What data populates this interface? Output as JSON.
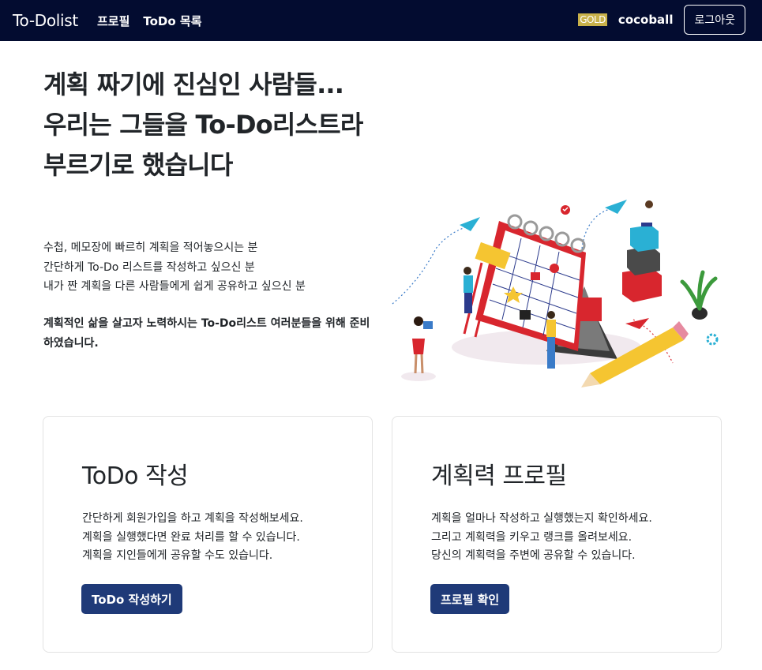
{
  "navbar": {
    "brand": "To-Dolist",
    "links": [
      "프로필",
      "ToDo 목록"
    ],
    "rank_badge": "GOLD",
    "username": "cocoball",
    "logout_label": "로그아웃",
    "bg_color": "#030c30",
    "badge_color": "#c8b14a"
  },
  "hero": {
    "title_lines": [
      "계획 짜기에 진심인 사람들...",
      "우리는 그들을 To-Do리스트라",
      "부르기로 했습니다"
    ],
    "desc_lines": [
      "수첩, 메모장에 빠르히 계획을 적어놓으시는 분",
      "간단하게 To-Do 리스트를 작성하고 싶으신 분",
      "내가 짠 계획을 다른 사람들에게 쉽게 공유하고 싶으신 분"
    ],
    "bold_text": "계획적인 삶을 살고자 노력하시는 To-Do리스트 여러분들을 위해 준비하였습니다."
  },
  "cards": [
    {
      "title": "ToDo 작성",
      "lines": [
        "간단하게 회원가입을 하고 계획을 작성해보세요.",
        "계획을 실행했다면 완료 처리를 할 수 있습니다.",
        "계획을 지인들에게 공유할 수도 있습니다."
      ],
      "button_label": "ToDo 작성하기"
    },
    {
      "title": "계획력 프로필",
      "lines": [
        "계획을 얼마나 작성하고 실행했는지 확인하세요.",
        "그리고 계획력을 키우고 랭크를 올려보세요.",
        "당신의 계획력을 주변에 공유할 수 있습니다."
      ],
      "button_label": "프로필 확인"
    }
  ],
  "colors": {
    "button": "#1f3a78",
    "accent_red": "#d8262e"
  }
}
